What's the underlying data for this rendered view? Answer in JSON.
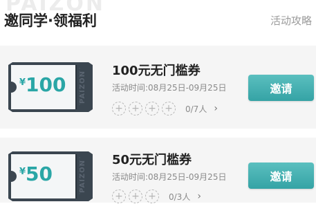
{
  "header": {
    "watermark": "PAIZON",
    "title": "邀同学·领福利",
    "guide_link": "活动攻略"
  },
  "coupons": [
    {
      "amount_symbol": "¥",
      "amount": "100",
      "side_brand": "PAIZON",
      "title": "100元无门槛券",
      "date": "活动时间:08月25日-09月25日",
      "slot_symbol": "+",
      "progress": "0/7人",
      "chevron": "›",
      "invite_label": "邀请"
    },
    {
      "amount_symbol": "¥",
      "amount": "50",
      "side_brand": "PAIZON",
      "title": "50元无门槛券",
      "date": "活动时间:08月25日-09月25日",
      "slot_symbol": "+",
      "progress": "0/3人",
      "chevron": "›",
      "invite_label": "邀请"
    }
  ],
  "colors": {
    "accent": "#3aa8a9",
    "voucher_dark": "#3b4650",
    "amount_text": "#2aa6a6"
  },
  "icons": [
    "plus-circle-icon",
    "chevron-right-icon"
  ]
}
